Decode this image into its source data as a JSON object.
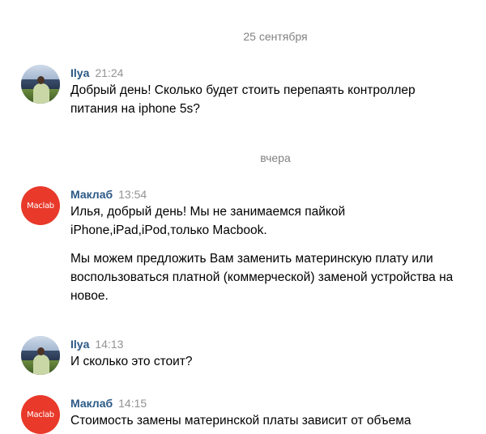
{
  "dates": {
    "first": "25 сентября",
    "second": "вчера"
  },
  "messages": [
    {
      "author": "Ilya",
      "time": "21:24",
      "avatar": "user-photo",
      "paragraphs": [
        "Добрый день! Сколько будет стоить перепаять контроллер питания на iphone 5s?"
      ]
    },
    {
      "author": "Маклаб",
      "time": "13:54",
      "avatar_text": "Maclab",
      "paragraphs": [
        "Илья, добрый день! Мы не занимаемся пайкой iPhone,iPad,iPod,только Macbook.",
        "Мы можем предложить Вам заменить материнскую плату или воспользоваться платной (коммерческой) заменой устройства на новое."
      ]
    },
    {
      "author": "Ilya",
      "time": "14:13",
      "avatar": "user-photo",
      "paragraphs": [
        "И сколько это стоит?"
      ]
    },
    {
      "author": "Маклаб",
      "time": "14:15",
      "avatar_text": "Maclab",
      "paragraphs": [
        "Стоимость замены материнской платы зависит от объема"
      ]
    }
  ],
  "colors": {
    "author": "#2a5885",
    "time": "#939393",
    "date_separator": "#828282",
    "brand_avatar": "#e8392a"
  }
}
